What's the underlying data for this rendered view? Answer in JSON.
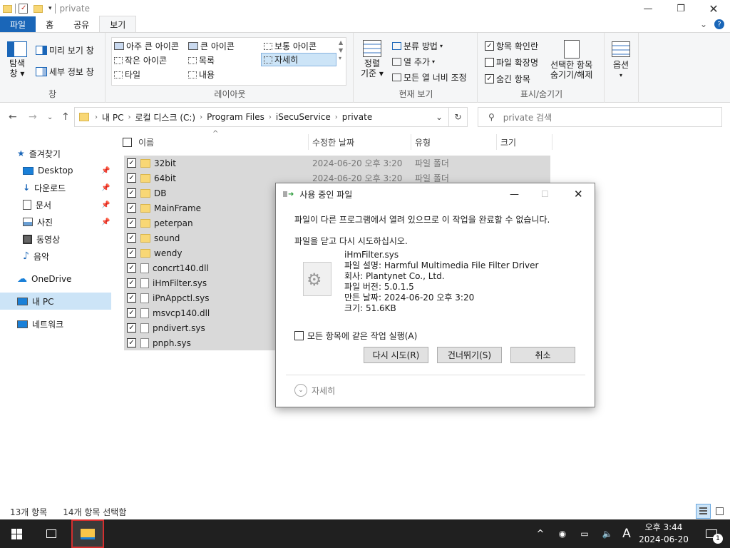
{
  "window": {
    "title": "private"
  },
  "ribbon_tabs": [
    "파일",
    "홈",
    "공유",
    "보기"
  ],
  "ribbon": {
    "pane": {
      "nav_pane": "탐색\n창",
      "preview_pane": "미리 보기 창",
      "details_pane": "세부 정보 창",
      "label": "창"
    },
    "layout": {
      "extra_large": "아주 큰 아이콘",
      "large": "큰 아이콘",
      "medium": "보통 아이콘",
      "small": "작은 아이콘",
      "list": "목록",
      "details": "자세히",
      "tiles": "타일",
      "content": "내용",
      "label": "레이아웃"
    },
    "current_view": {
      "sort": "정렬\n기준",
      "group_by": "분류 방법",
      "add_columns": "열 추가",
      "size_all_columns": "모든 열 너비 조정",
      "label": "현재 보기"
    },
    "show_hide": {
      "item_checkboxes": "항목 확인란",
      "file_extensions": "파일 확장명",
      "hidden_items": "숨긴 항목",
      "hide_selected": "선택한 항목\n숨기기/해제",
      "label": "표시/숨기기"
    },
    "options": {
      "label": "옵션"
    }
  },
  "address": {
    "crumbs": [
      "내 PC",
      "로컬 디스크 (C:)",
      "Program Files",
      "iSecuService",
      "private"
    ],
    "search_placeholder": "private 검색"
  },
  "sidebar": {
    "quick_access": "즐겨찾기",
    "items": [
      "Desktop",
      "다운로드",
      "문서",
      "사진",
      "동영상",
      "음악"
    ],
    "onedrive": "OneDrive",
    "this_pc": "내 PC",
    "network": "네트워크"
  },
  "columns": {
    "name": "이름",
    "date": "수정한 날짜",
    "type": "유형",
    "size": "크기"
  },
  "files": [
    {
      "name": "32bit",
      "date": "2024-06-20 오후 3:20",
      "type": "파일 폴더",
      "kind": "folder"
    },
    {
      "name": "64bit",
      "date": "2024-06-20 오후 3:20",
      "type": "파일 폴더",
      "kind": "folder"
    },
    {
      "name": "DB",
      "date": "",
      "type": "",
      "kind": "folder"
    },
    {
      "name": "MainFrame",
      "date": "",
      "type": "",
      "kind": "folder"
    },
    {
      "name": "peterpan",
      "date": "",
      "type": "",
      "kind": "folder"
    },
    {
      "name": "sound",
      "date": "",
      "type": "",
      "kind": "folder"
    },
    {
      "name": "wendy",
      "date": "",
      "type": "",
      "kind": "folder"
    },
    {
      "name": "concrt140.dll",
      "date": "",
      "type": "",
      "kind": "file"
    },
    {
      "name": "iHmFilter.sys",
      "date": "",
      "type": "",
      "kind": "file"
    },
    {
      "name": "iPnAppctl.sys",
      "date": "",
      "type": "",
      "kind": "file"
    },
    {
      "name": "msvcp140.dll",
      "date": "",
      "type": "",
      "kind": "file"
    },
    {
      "name": "pndivert.sys",
      "date": "",
      "type": "",
      "kind": "file"
    },
    {
      "name": "pnph.sys",
      "date": "",
      "type": "",
      "kind": "file"
    }
  ],
  "status": {
    "count": "13개 항목",
    "selected": "14개 항목 선택함"
  },
  "dialog": {
    "title": "사용 중인 파일",
    "message": "파일이 다른 프로그램에서 열려 있으므로 이 작업을 완료할 수 없습니다.",
    "instruction": "파일을 닫고 다시 시도하십시오.",
    "file_name": "iHmFilter.sys",
    "file_desc": "파일 설명: Harmful Multimedia File Filter Driver",
    "company": "회사: Plantynet Co., Ltd.",
    "version": "파일 버전: 5.0.1.5",
    "created": "만든 날짜: 2024-06-20 오후 3:20",
    "size": "크기: 51.6KB",
    "apply_all": "모든 항목에 같은 작업 실행(A)",
    "retry": "다시 시도(R)",
    "skip": "건너뛰기(S)",
    "cancel": "취소",
    "details": "자세히"
  },
  "taskbar": {
    "ime": "A",
    "time": "오후 3:44",
    "date": "2024-06-20",
    "notification_count": "1"
  }
}
